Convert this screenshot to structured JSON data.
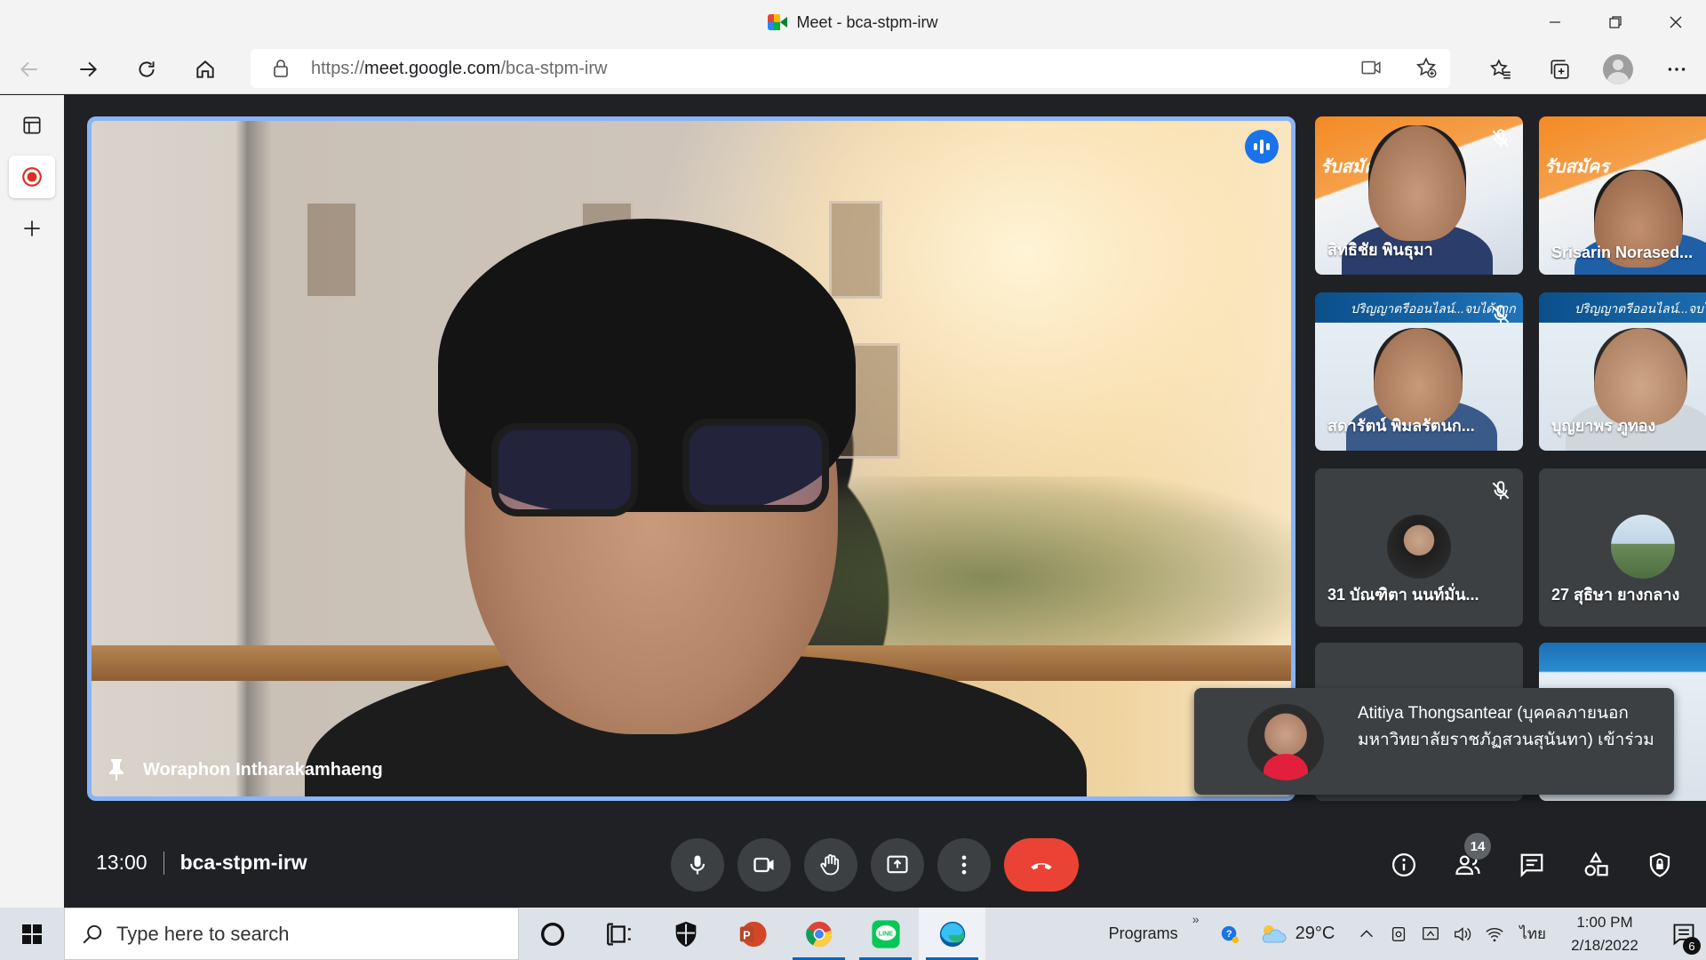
{
  "window": {
    "title": "Meet - bca-stpm-irw",
    "controls": [
      "minimize",
      "restore",
      "close"
    ]
  },
  "browser": {
    "url_prefix": "https://",
    "url_host": "meet.google.com",
    "url_path": "/bca-stpm-irw",
    "nav_icons": [
      "back-icon",
      "forward-icon",
      "refresh-icon",
      "home-icon"
    ],
    "address_icons": [
      "camera-icon",
      "add-favorite-icon"
    ],
    "toolbar_icons": [
      "favorites-icon",
      "collections-icon",
      "profile-icon",
      "more-icon"
    ]
  },
  "sidebar": {
    "items": [
      "tab-actions-icon",
      "record-icon",
      "add-icon"
    ]
  },
  "meeting": {
    "time": "13:00",
    "code": "bca-stpm-irw",
    "participant_count": "14",
    "main_speaker": {
      "name": "Woraphon Intharakamhaeng"
    },
    "tiles": [
      {
        "name": "สิทธิชัย พินธุมา",
        "muted": true,
        "overlay": "รับสมัคร"
      },
      {
        "name": "Srisarin Norased...",
        "muted": true,
        "overlay": "รับสมัคร"
      },
      {
        "name": "สดารัตน์ พิมลรัตนก...",
        "muted": true,
        "banner": "ปริญญาตรีออนไลน์...จบได้จาก"
      },
      {
        "name": "บุญยาพร ภูทอง",
        "muted": true,
        "banner": "ปริญญาตรีออนไลน์...จบได้จาก"
      },
      {
        "name": "31 บัณฑิตา นนท์มั่น...",
        "muted": true
      },
      {
        "name": "27 สุธิษา ยางกลาง",
        "muted": true
      }
    ],
    "notification": {
      "text": "Atitiya Thongsantear (บุคคลภายนอก มหาวิทยาลัยราชภัฏสวนสุนันทา) เข้าร่วม"
    },
    "controls": [
      "microphone-icon",
      "camera-icon",
      "raise-hand-icon",
      "present-icon",
      "more-options-icon",
      "end-call-icon"
    ],
    "right_controls": [
      "info-icon",
      "people-icon",
      "chat-icon",
      "activities-icon",
      "host-controls-icon"
    ]
  },
  "taskbar": {
    "search_placeholder": "Type here to search",
    "apps": [
      "cortana-icon",
      "task-view-icon",
      "security-icon",
      "powerpoint-icon",
      "chrome-icon",
      "line-icon",
      "edge-icon"
    ],
    "programs_label": "Programs",
    "chevron": "»",
    "temperature": "29°C",
    "language": "ไทย",
    "time": "1:00 PM",
    "date": "2/18/2022",
    "notification_count": "6"
  }
}
